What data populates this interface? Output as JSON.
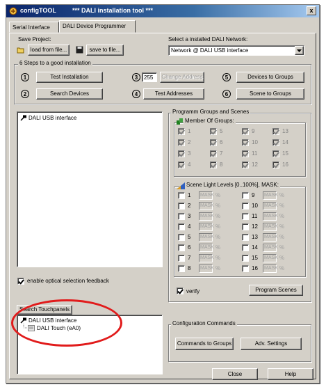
{
  "window": {
    "app_name": "configTOOL",
    "subtitle": "*** DALI installation tool ***",
    "close_label": "x"
  },
  "tabs": [
    "Serial Interface",
    "DALI Device Programmer"
  ],
  "save_project": {
    "label": "Save Project:",
    "load_button": "load from file...",
    "save_button": "save to file..."
  },
  "network": {
    "label": "Select a installed DALI Network:",
    "selected": "Network @ DALI USB interface"
  },
  "steps": {
    "label": "6 Steps to a good installation",
    "test_installation": {
      "num": "1",
      "label": "Test Installation"
    },
    "search_devices": {
      "num": "2",
      "label": "Search Devices"
    },
    "change_address": {
      "num": "3",
      "value": "255",
      "label": "Change Address"
    },
    "test_addresses": {
      "num": "4",
      "label": "Test Addresses"
    },
    "devices_to_groups": {
      "num": "5",
      "label": "Devices to Groups"
    },
    "scene_to_groups": {
      "num": "6",
      "label": "Scene to Groups"
    }
  },
  "device_tree": {
    "root": "DALI USB interface"
  },
  "optical_feedback": {
    "label": "enable optical selection feedback",
    "checked": true
  },
  "search_touchpanels": {
    "label": "Search Touchpanels",
    "root": "DALI USB interface",
    "child": "DALI Touch (eA0)"
  },
  "programm": {
    "label": "Programm Groups and Scenes",
    "member_label": "Member Of Groups:",
    "groups": [
      "1",
      "2",
      "3",
      "4",
      "5",
      "6",
      "7",
      "8",
      "9",
      "10",
      "11",
      "12",
      "13",
      "14",
      "15",
      "16"
    ],
    "scene_label": "Scene Light Levels [0..100%], MASK:",
    "scenes": [
      "1",
      "2",
      "3",
      "4",
      "5",
      "6",
      "7",
      "8",
      "9",
      "10",
      "11",
      "12",
      "13",
      "14",
      "15",
      "16"
    ],
    "mask_text": "MASK",
    "pct": "%",
    "verify_label": "verify",
    "verify_checked": true,
    "program_button": "Program Scenes"
  },
  "config": {
    "label": "Configuration Commands",
    "commands_button": "Commands to Groups",
    "adv_button": "Adv. Settings"
  },
  "footer": {
    "close": "Close",
    "help": "Help"
  },
  "colors": {
    "title_start": "#0a246a",
    "title_end": "#a6caf0",
    "face": "#d4d0c8",
    "annotation": "#e11b1b"
  }
}
